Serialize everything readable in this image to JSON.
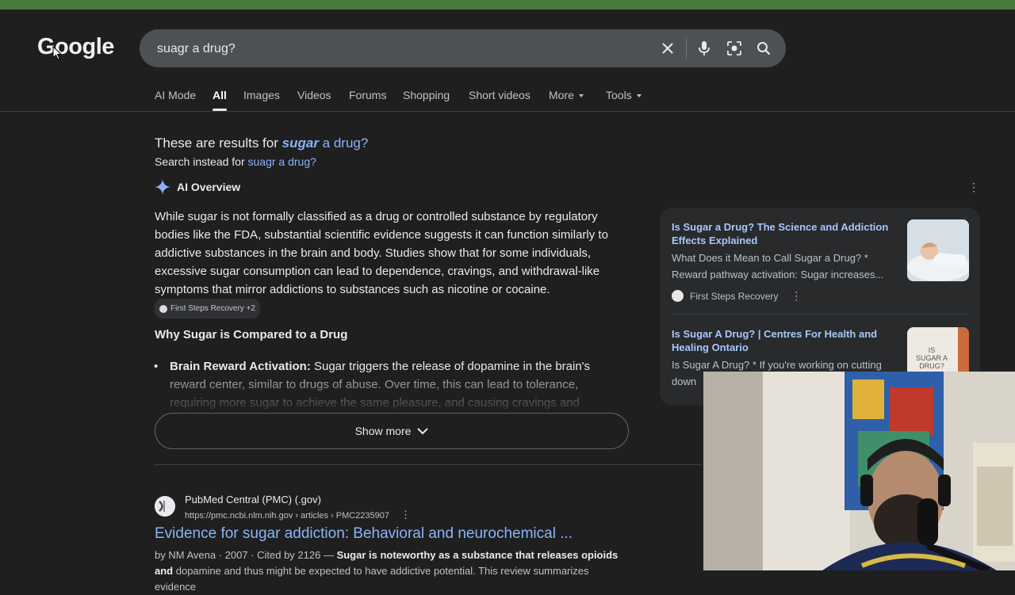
{
  "brand": {
    "logo": "Google"
  },
  "search": {
    "query": "suagr a drug?"
  },
  "icons": [
    "close-icon",
    "mic-icon",
    "lens-icon",
    "search-icon",
    "sparkle-icon",
    "kebab-icon",
    "chevron-down-icon"
  ],
  "tabs": [
    {
      "label": "AI Mode"
    },
    {
      "label": "All"
    },
    {
      "label": "Images"
    },
    {
      "label": "Videos"
    },
    {
      "label": "Forums"
    },
    {
      "label": "Shopping"
    },
    {
      "label": "Short videos"
    },
    {
      "label": "More"
    },
    {
      "label": "Tools"
    }
  ],
  "spelling": {
    "prefix": "These are results for",
    "corrected_bold": "sugar",
    "corrected_rest": " a drug?",
    "instead_prefix": "Search instead for",
    "instead_link": "suagr a drug?"
  },
  "ai_overview": {
    "label": "AI Overview",
    "paragraph": "While sugar is not formally classified as a drug or controlled substance by regulatory bodies like the FDA, substantial scientific evidence suggests it can function similarly to addictive substances in the brain and body. Studies show that for some individuals, excessive sugar consumption can lead to dependence, cravings, and withdrawal-like symptoms that mirror addictions to substances such as nicotine or cocaine.",
    "chip": "First Steps Recovery +2",
    "heading": "Why Sugar is Compared to a Drug",
    "bullet_bold": "Brain Reward Activation:",
    "bullet_text": " Sugar triggers the release of dopamine in the brain's reward center, similar to drugs of abuse. Over time, this can lead to tolerance, requiring more sugar to achieve the same pleasure, and causing cravings and",
    "show_more": "Show more"
  },
  "sources": [
    {
      "title": "Is Sugar a Drug? The Science and Addiction Effects Explained",
      "snippet": "What Does it Mean to Call Sugar a Drug? * Reward pathway activation: Sugar increases...",
      "source": "First Steps Recovery"
    },
    {
      "title": "Is Sugar A Drug? | Centres For Health and Healing Ontario",
      "snippet": "Is Sugar A Drug? * If you're working on cutting down",
      "thumb_text": "IS SUGAR A DRUG?"
    }
  ],
  "result": {
    "site": "PubMed Central (PMC) (.gov)",
    "url": "https://pmc.ncbi.nlm.nih.gov › articles › PMC2235907",
    "title": "Evidence for sugar addiction: Behavioral and neurochemical ...",
    "meta": "by NM Avena · 2007 · Cited by 2126 — ",
    "snippet_bold": "Sugar is noteworthy as a substance that releases opioids and",
    "snippet_rest": " dopamine and thus might be expected to have addictive potential. This review summarizes evidence"
  },
  "colors": {
    "accent": "#8ab4f8",
    "background": "#1f1f1f",
    "topbar": "#4a7a3c"
  }
}
